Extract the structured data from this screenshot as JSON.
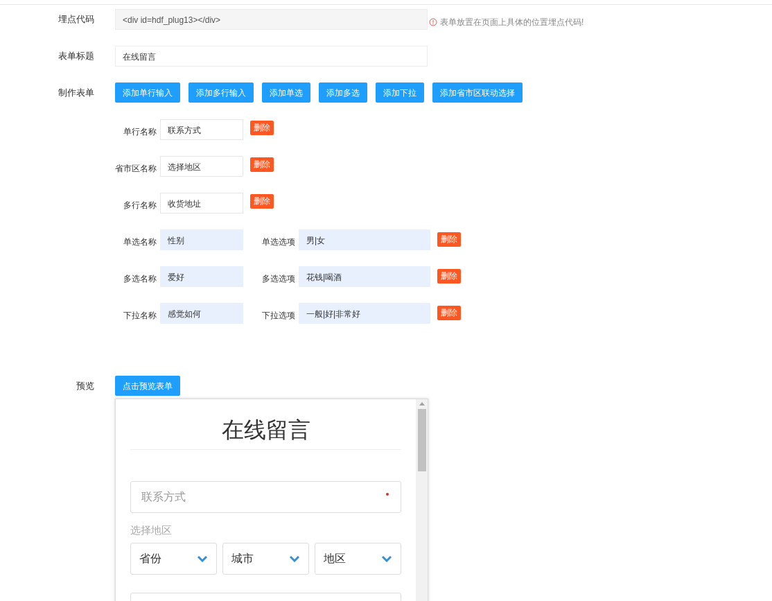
{
  "embed_code": {
    "label": "埋点代码",
    "value": "<div id=hdf_plug13></div>",
    "hint": "表单放置在页面上具体的位置埋点代码!"
  },
  "form_title": {
    "label": "表单标题",
    "value": "在线留言"
  },
  "builder": {
    "label": "制作表单",
    "buttons": [
      "添加单行输入",
      "添加多行输入",
      "添加单选",
      "添加多选",
      "添加下拉",
      "添加省市区联动选择"
    ]
  },
  "fields": [
    {
      "kind": "plain",
      "name_label": "单行名称",
      "name_value": "联系方式",
      "delete": "删除"
    },
    {
      "kind": "plain",
      "name_label": "省市区名称",
      "name_value": "选择地区",
      "delete": "删除"
    },
    {
      "kind": "plain",
      "name_label": "多行名称",
      "name_value": "收货地址",
      "delete": "删除"
    },
    {
      "kind": "choice",
      "name_label": "单选名称",
      "name_value": "性别",
      "options_label": "单选选项",
      "options_value": "男|女",
      "delete": "删除"
    },
    {
      "kind": "choice",
      "name_label": "多选名称",
      "name_value": "爱好",
      "options_label": "多选选项",
      "options_value": "花钱|喝酒",
      "delete": "删除"
    },
    {
      "kind": "choice",
      "name_label": "下拉名称",
      "name_value": "感觉如何",
      "options_label": "下拉选项",
      "options_value": "一般|好|非常好",
      "delete": "删除"
    }
  ],
  "preview": {
    "label": "预览",
    "button": "点击预览表单",
    "title": "在线留言",
    "contact_placeholder": "联系方式",
    "contact_required": true,
    "region_label": "选择地区",
    "selects": [
      "省份",
      "城市",
      "地区"
    ]
  }
}
